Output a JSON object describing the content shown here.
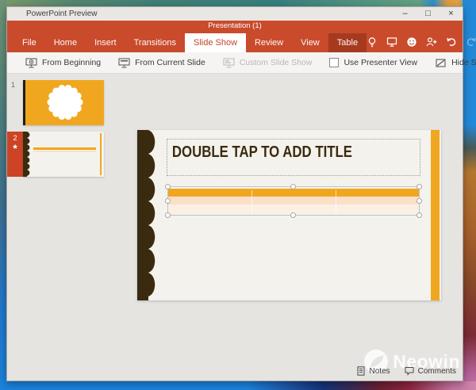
{
  "window": {
    "title": "PowerPoint Preview",
    "controls": {
      "minimize": "–",
      "maximize": "□",
      "close": "×"
    }
  },
  "ribbon": {
    "document_title": "Presentation (1)",
    "tabs": [
      {
        "label": "File",
        "active": false
      },
      {
        "label": "Home",
        "active": false
      },
      {
        "label": "Insert",
        "active": false
      },
      {
        "label": "Transitions",
        "active": false
      },
      {
        "label": "Slide Show",
        "active": true
      },
      {
        "label": "Review",
        "active": false
      },
      {
        "label": "View",
        "active": false
      },
      {
        "label": "Table",
        "active": false,
        "contextual": true
      }
    ],
    "action_icons": [
      "lightbulb-tell-me",
      "present-to-screen",
      "feedback-smiley",
      "add-people",
      "undo",
      "redo"
    ]
  },
  "toolbar": {
    "from_beginning": "From Beginning",
    "from_current_slide": "From Current Slide",
    "custom_slide_show": "Custom Slide Show",
    "custom_slide_show_disabled": true,
    "use_presenter_view": "Use Presenter View",
    "use_presenter_view_checked": false,
    "hide_slide": "Hide Slide"
  },
  "thumbnail_panel": {
    "slides": [
      {
        "number": "1",
        "selected": false
      },
      {
        "number": "2",
        "selected": true,
        "star": "★"
      }
    ]
  },
  "slide_editor": {
    "title_placeholder": "DOUBLE TAP TO ADD TITLE",
    "table": {
      "rows": 3,
      "columns": 3,
      "selected": true,
      "header_color": "#f0a71f",
      "row_colors": [
        "#fbe0c8",
        "#fcefe3"
      ]
    }
  },
  "statusbar": {
    "notes": "Notes",
    "comments": "Comments"
  },
  "watermark": {
    "text": "Neowin"
  },
  "colors": {
    "ribbon_red": "#c94b2c",
    "contextual_tab_red": "#a63a1f",
    "accent_orange": "#f0a71f",
    "slide_brown": "#3a2b10",
    "selection_red": "#cc4425",
    "slide_bg": "#f4f2ec",
    "canvas_bg": "#e6e4e1",
    "titlebar_bg": "#e9e7e4"
  }
}
